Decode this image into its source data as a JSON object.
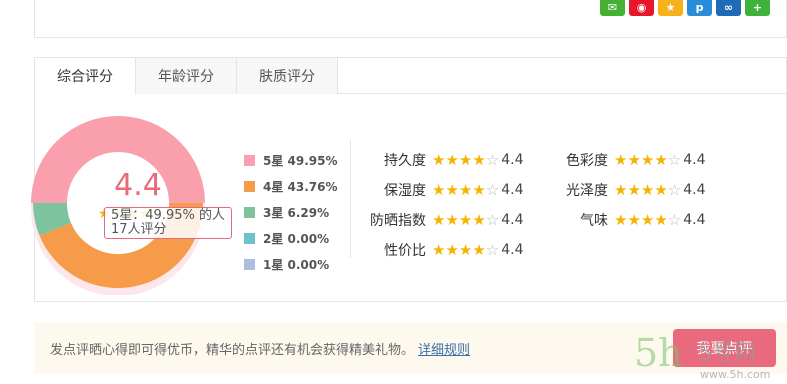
{
  "share": {
    "icons": [
      {
        "name": "wechat-icon",
        "glyph": "✉",
        "color": "#46b035"
      },
      {
        "name": "weibo-icon",
        "glyph": "◉",
        "color": "#e6162d"
      },
      {
        "name": "qzone-icon",
        "glyph": "★",
        "color": "#f5b21c"
      },
      {
        "name": "pinterest-icon",
        "glyph": "p",
        "color": "#2b8cd8"
      },
      {
        "name": "renren-icon",
        "glyph": "∞",
        "color": "#1f6bb5"
      },
      {
        "name": "more-share-icon",
        "glyph": "+",
        "color": "#3db33b"
      }
    ]
  },
  "tabs": [
    {
      "label": "综合评分",
      "active": true
    },
    {
      "label": "年龄评分",
      "active": false
    },
    {
      "label": "肤质评分",
      "active": false
    }
  ],
  "overall": {
    "score": "4.4",
    "tooltip_line1": "5星：49.95% 的人",
    "tooltip_line2": "17人评分"
  },
  "chart_data": {
    "type": "pie",
    "categories": [
      "5星",
      "4星",
      "3星",
      "2星",
      "1星"
    ],
    "values": [
      49.95,
      43.76,
      6.29,
      0.0,
      0.0
    ],
    "colors": [
      "#f9a0ac",
      "#f59b4a",
      "#7dc39e",
      "#6cc3cf",
      "#a9bfdc"
    ],
    "labels": [
      "5星 49.95%",
      "4星 43.76%",
      "3星 6.29%",
      "2星 0.00%",
      "1星 0.00%"
    ]
  },
  "attributes": [
    {
      "label": "持久度",
      "value": "4.4"
    },
    {
      "label": "保湿度",
      "value": "4.4"
    },
    {
      "label": "防晒指数",
      "value": "4.4"
    },
    {
      "label": "性价比",
      "value": "4.4"
    },
    {
      "label": "色彩度",
      "value": "4.4"
    },
    {
      "label": "光泽度",
      "value": "4.4"
    },
    {
      "label": "气味",
      "value": "4.4"
    }
  ],
  "notice": {
    "text": "发点评晒心得即可得优币，精华的点评还有机会获得精美礼物。",
    "link": "详细规则"
  },
  "review_button": "我要点评",
  "watermark": {
    "text": "5号网",
    "url_text": "www.5h.com"
  }
}
